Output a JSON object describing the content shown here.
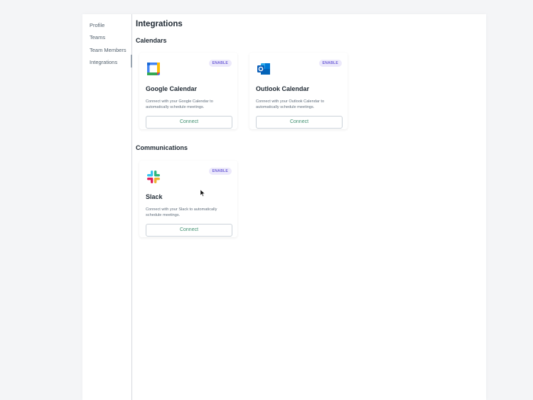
{
  "sidebar": {
    "items": [
      {
        "label": "Profile"
      },
      {
        "label": "Teams"
      },
      {
        "label": "Team Members"
      },
      {
        "label": "Integrations",
        "active": true
      }
    ]
  },
  "main": {
    "title": "Integrations",
    "sections": [
      {
        "title": "Calendars",
        "cards": [
          {
            "icon": "google-calendar-icon",
            "badge": "ENABLE",
            "title": "Google Calendar",
            "description": "Connect with your Google Calendar to automatically schedule meetings.",
            "button_label": "Connect"
          },
          {
            "icon": "outlook-icon",
            "badge": "ENABLE",
            "title": "Outlook Calendar",
            "description": "Connect with your Outlook Calendar to automatically schedule meetings.",
            "button_label": "Connect"
          }
        ]
      },
      {
        "title": "Communications",
        "cards": [
          {
            "icon": "slack-icon",
            "badge": "ENABLE",
            "title": "Slack",
            "description": "Connect with your Slack to automatically schedule meetings.",
            "button_label": "Connect"
          }
        ]
      }
    ]
  },
  "colors": {
    "badge_bg": "#ece9fb",
    "badge_text": "#6b5bd6",
    "connect_text": "#3f8f6f"
  }
}
